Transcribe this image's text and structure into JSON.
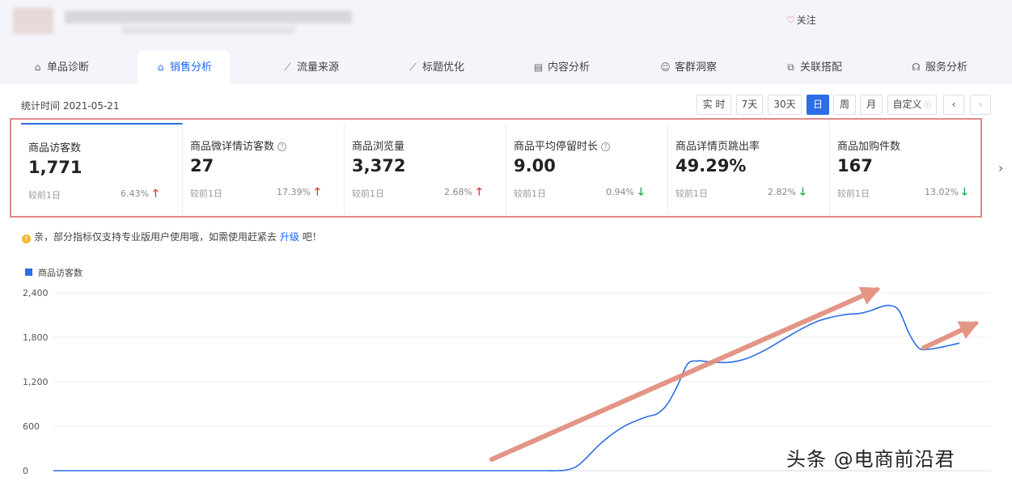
{
  "header": {
    "follow_label": "关注"
  },
  "tabs": [
    {
      "label": "单品诊断",
      "icon": "bag-icon"
    },
    {
      "label": "销售分析",
      "icon": "bag-icon"
    },
    {
      "label": "流量来源",
      "icon": "trend-icon"
    },
    {
      "label": "标题优化",
      "icon": "trend-icon"
    },
    {
      "label": "内容分析",
      "icon": "document-icon"
    },
    {
      "label": "客群洞察",
      "icon": "users-icon"
    },
    {
      "label": "关联搭配",
      "icon": "link-icon"
    },
    {
      "label": "服务分析",
      "icon": "headset-icon"
    }
  ],
  "active_tab": "销售分析",
  "stat": {
    "time_label": "统计时间 2021-05-21",
    "buttons": [
      "实 时",
      "7天",
      "30天",
      "日",
      "周",
      "月",
      "自定义"
    ],
    "active_button": "日"
  },
  "metrics": [
    {
      "label": "商品访客数",
      "value": "1,771",
      "compare": "较前1日",
      "pct": "6.43%",
      "dir": "up",
      "help": false
    },
    {
      "label": "商品微详情访客数",
      "value": "27",
      "compare": "较前1日",
      "pct": "17.39%",
      "dir": "up",
      "help": true
    },
    {
      "label": "商品浏览量",
      "value": "3,372",
      "compare": "较前1日",
      "pct": "2.68%",
      "dir": "up",
      "help": false
    },
    {
      "label": "商品平均停留时长",
      "value": "9.00",
      "compare": "较前1日",
      "pct": "0.94%",
      "dir": "down",
      "help": true
    },
    {
      "label": "商品详情页跳出率",
      "value": "49.29%",
      "compare": "较前1日",
      "pct": "2.82%",
      "dir": "down",
      "help": false
    },
    {
      "label": "商品加购件数",
      "value": "167",
      "compare": "较前1日",
      "pct": "13.02%",
      "dir": "down",
      "help": false
    }
  ],
  "notice": {
    "text": "亲，部分指标仅支持专业版用户使用哦，如需使用赶紧去",
    "link": "升级",
    "suffix": "吧！"
  },
  "watermark": "头条 @电商前沿君",
  "colors": {
    "accent": "#2b6ee6",
    "up": "#e3342f",
    "down": "#1aa34a",
    "highlight": "#e08a8a"
  },
  "chart_data": {
    "type": "line",
    "series": [
      {
        "name": "商品访客数",
        "color": "#2b6ee6",
        "values": [
          0,
          0,
          0,
          0,
          0,
          0,
          0,
          0,
          0,
          0,
          0,
          0,
          0,
          0,
          0,
          0,
          0,
          0,
          0,
          0,
          0,
          0,
          0,
          0,
          0,
          0,
          0,
          0,
          0,
          0,
          0,
          0,
          0,
          0,
          0,
          0,
          0,
          0,
          0,
          0,
          0,
          0,
          0,
          0,
          0,
          0,
          0,
          0,
          0,
          0,
          0,
          10,
          60,
          180,
          320,
          440,
          540,
          620,
          680,
          730,
          770,
          900,
          1150,
          1440,
          1480,
          1470,
          1460,
          1460,
          1480,
          1520,
          1580,
          1650,
          1730,
          1810,
          1890,
          1960,
          2020,
          2060,
          2090,
          2110,
          2120,
          2150,
          2200,
          2230,
          2160,
          1850,
          1650,
          1640,
          1660,
          1690,
          1720
        ]
      }
    ],
    "yticks": [
      "0",
      "600",
      "1,200",
      "1,800",
      "2,400"
    ],
    "ylim": [
      0,
      2400
    ],
    "grid": true,
    "legend_position": "top-left"
  }
}
